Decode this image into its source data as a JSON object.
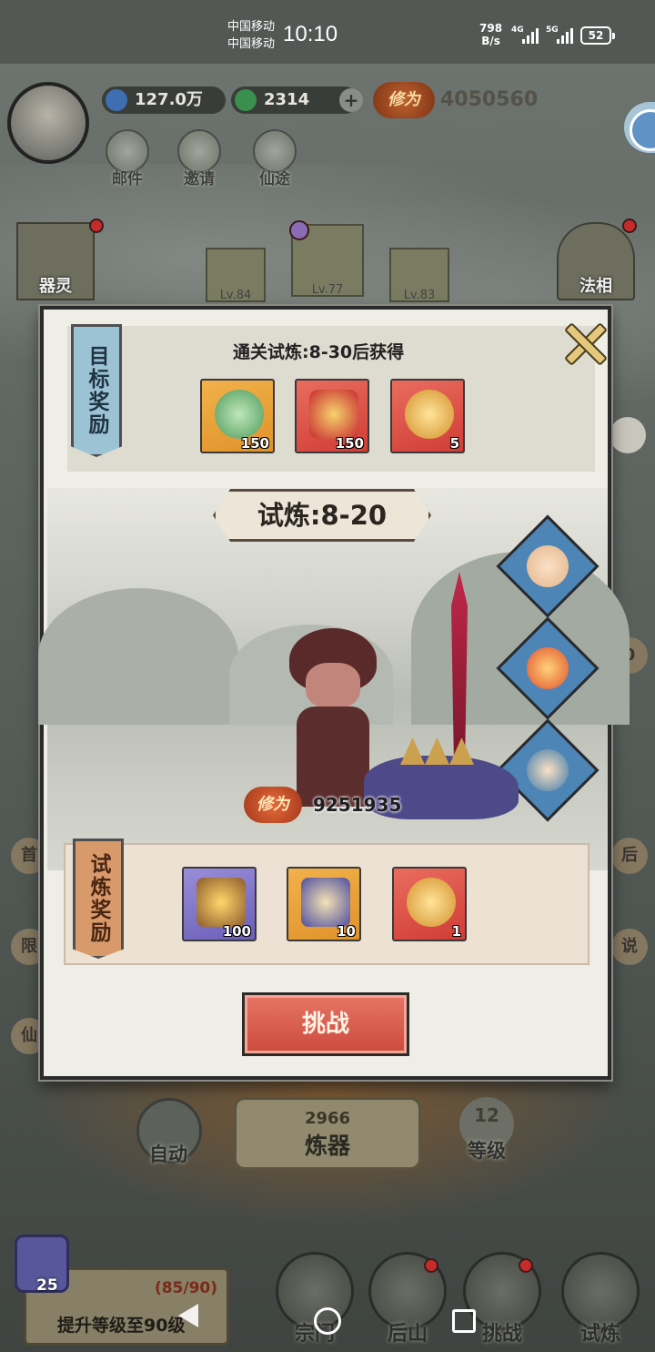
{
  "status_bar": {
    "carrier_1": "中国移动",
    "carrier_2": "中国移动",
    "time": "10:10",
    "net_speed_value": "798",
    "net_speed_unit": "B/s",
    "sig1": "4G",
    "sig2": "5G",
    "battery": "52"
  },
  "top": {
    "currency_spirit": "127.0万",
    "currency_jade": "2314",
    "plus": "+",
    "xiuwei_label": "修为",
    "xiuwei_value": "4050560",
    "buttons": [
      {
        "label": "邮件",
        "icon": "mail-icon"
      },
      {
        "label": "邀请",
        "icon": "invite-icon"
      },
      {
        "label": "仙途",
        "icon": "path-icon"
      }
    ]
  },
  "background": {
    "qiling": "器灵",
    "faxiang": "法相",
    "equip_levels": [
      "Lv.84",
      "Lv.77",
      "Lv.83"
    ],
    "edge_left": [
      "首",
      "限",
      "仙"
    ],
    "edge_right": [
      "0",
      "后",
      "说"
    ]
  },
  "modal": {
    "target_ribbon": "目标奖励",
    "target_title": "通关试炼:8-30后获得",
    "target_rewards": [
      {
        "name": "green-spirit-flame",
        "qty": "150",
        "bg": "orange"
      },
      {
        "name": "red-treasure-pouch",
        "qty": "150",
        "bg": "red"
      },
      {
        "name": "golden-orb",
        "qty": "5",
        "bg": "red"
      }
    ],
    "stage": "试炼:8-20",
    "power_label": "修为",
    "power_value": "9251935",
    "trial_ribbon": "试炼奖励",
    "trial_rewards": [
      {
        "name": "treasure-chest",
        "qty": "100",
        "bg": "purple"
      },
      {
        "name": "blue-scroll",
        "qty": "10",
        "bg": "orange"
      },
      {
        "name": "golden-orb",
        "qty": "1",
        "bg": "red"
      }
    ],
    "challenge": "挑战"
  },
  "bottom": {
    "auto": "自动",
    "forge_count": "2966",
    "forge": "炼器",
    "level_num": "12",
    "level": "等级",
    "upgrade_progress": "(85/90)",
    "upgrade_text": "提升等级至90级",
    "scroll_count": "25",
    "nav": [
      "宗门",
      "后山",
      "挑战",
      "试炼"
    ]
  },
  "colors": {
    "modal_bg": "#efeee6",
    "ribbon_blue": "#9cc3d4",
    "ribbon_orange": "#d99a6b",
    "challenge_red": "#d8574a"
  }
}
